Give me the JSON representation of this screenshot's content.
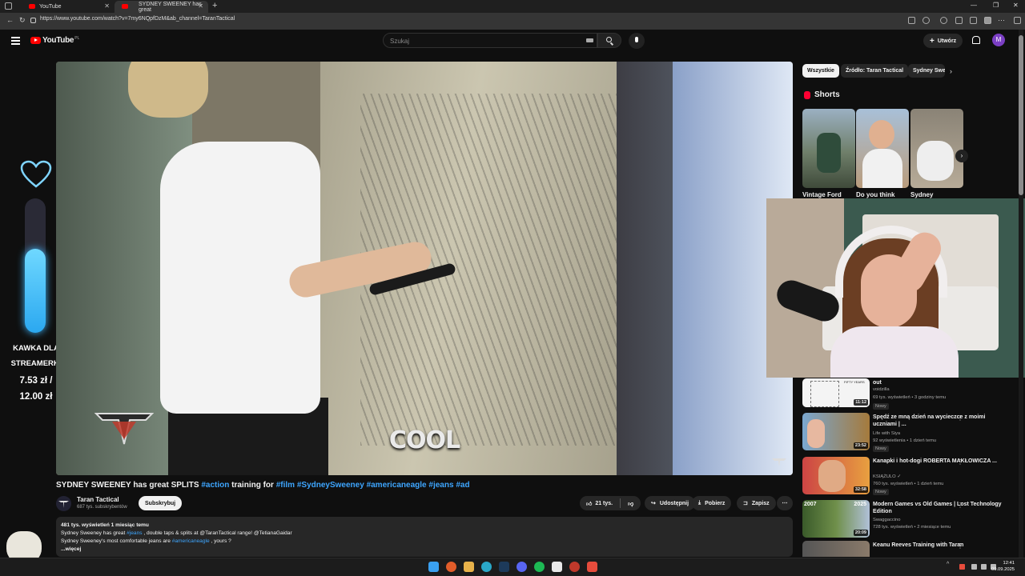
{
  "browser": {
    "tabs": [
      {
        "label": "YouTube"
      },
      {
        "label": "SYDNEY SWEENEY has great"
      }
    ],
    "url": "https://www.youtube.com/watch?v=7my6NQpfDzM&ab_channel=TaranTactical"
  },
  "masthead": {
    "logo_text": "YouTube",
    "logo_country": "PL",
    "search_placeholder": "Szukaj",
    "create_label": "Utwórz",
    "avatar_letter": "M"
  },
  "overlay": {
    "donate_title_line1": "KAWKA DLA",
    "donate_title_line2": "STREAMERKI",
    "donate_current": "7.53 zł /",
    "donate_goal": "12.00 zł"
  },
  "video": {
    "caption": "COOL",
    "title_parts": {
      "start": "SYDNEY SWEENEY has great SPLITS ",
      "tag1": "#action",
      "mid": " training for ",
      "tag2": "#film",
      "tag3": "#SydneySweeney",
      "tag4": "#americaneagle",
      "tag5": "#jeans",
      "tag6": "#ad"
    },
    "channel_name": "Taran Tactical",
    "channel_subs": "687 tys. subskrybentów",
    "subscribe_label": "Subskrybuj",
    "likes": "21 tys.",
    "share_label": "Udostępnij",
    "download_label": "Pobierz",
    "save_label": "Zapisz"
  },
  "description": {
    "meta": "481 tys. wyświetleń  1 miesiąc temu",
    "line1_a": "Sydney Sweeney has great ",
    "line1_tag": "#jeans",
    "line1_b": " , double taps & splits at  @TaranTactical  range!  @TetianaGaidar",
    "line2_a": "Sydney Sweeney's most comfortable jeans are ",
    "line2_tag": "#americaneagle",
    "line2_b": " , yours ?",
    "more": "...więcej"
  },
  "sidebar": {
    "chips": [
      "Wszystkie",
      "Źródło: Taran Tactical",
      "Sydney Sweeney"
    ],
    "shorts_title": "Shorts",
    "shorts": [
      {
        "title": "Vintage Ford"
      },
      {
        "title": "Do you think"
      },
      {
        "title": "Sydney"
      }
    ],
    "recommendations": [
      {
        "title": "out",
        "channel": "voidzilla",
        "views": "69 tys. wyświetleń • 3 godziny temu",
        "badge": "Nowy",
        "duration": "11:12"
      },
      {
        "title": "Spędź ze mną dzień na wycieczce z moimi uczniami | ...",
        "channel": "Life with Siya",
        "views": "92 wyświetlenia • 1 dzień temu",
        "badge": "Nowy",
        "duration": "23:52"
      },
      {
        "title": "Kanapki i hot-dogi ROBERTA MAKŁOWICZA ...",
        "channel": "KSIĄŻULO ✓",
        "views": "760 tys. wyświetleń • 1 dzień temu",
        "badge": "Nowy",
        "duration": "32:58"
      },
      {
        "title": "Modern Games vs Old Games | Lost Technology Edition",
        "channel": "Swaggaccino",
        "views": "728 tys. wyświetleń • 2 miesiące temu",
        "badge": "",
        "duration": "20:09"
      },
      {
        "title": "Keanu Reeves Training with Taran",
        "channel": "",
        "views": "",
        "badge": "",
        "duration": ""
      }
    ]
  },
  "taskbar": {
    "time": "12:41",
    "date": "09.09.2025"
  },
  "colors": {
    "accent_red": "#ff0000",
    "link_blue": "#3ea6ff",
    "meter_blue": "#2ba8f0"
  },
  "donation_progress": 0.6275
}
